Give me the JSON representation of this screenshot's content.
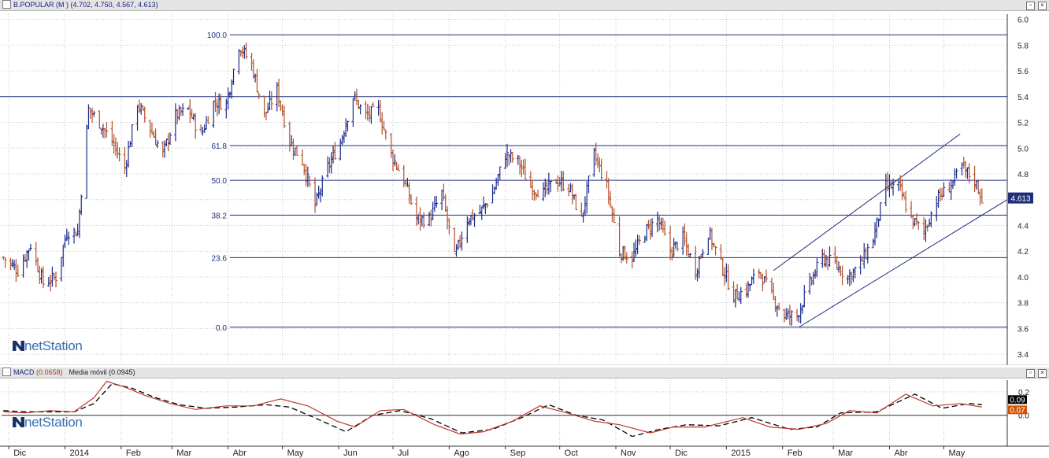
{
  "main_panel": {
    "title": "B.POPULAR (M )",
    "ohlc": "(4.702, 4.750, 4.567, 4.613)",
    "last_price_tag": "4.613",
    "logo": "netStation"
  },
  "macd_panel": {
    "macd_label": "MACD",
    "macd_value": "(0.0658)",
    "ma_label": "Media móvil",
    "ma_value": "(0.0945)",
    "tag_ma": "0.09",
    "tag_macd": "0.07",
    "logo": "netStation"
  },
  "colors": {
    "up_bar": "#1c2a8c",
    "down_bar": "#b2502a",
    "level_line": "#1f2d7a",
    "macd_line": "#c0392b",
    "signal_line": "#000000",
    "price_tag_bg": "#1f2d7a",
    "macd_tag_bg": "#d35400",
    "signal_tag_bg": "#000000"
  },
  "chart_data": [
    {
      "type": "ohlc",
      "title": "B.POPULAR (M )",
      "y_ticks": [
        "3.4",
        "3.6",
        "3.8",
        "4.0",
        "4.2",
        "4.4",
        "4.6",
        "4.8",
        "5.0",
        "5.2",
        "5.4",
        "5.6",
        "5.8",
        "6.0"
      ],
      "ylim": [
        3.34,
        6.04
      ],
      "x_ticks": [
        "Dic",
        "2014",
        "Feb",
        "Mar",
        "Abr",
        "May",
        "Jun",
        "Jul",
        "Ago",
        "Sep",
        "Oct",
        "Nov",
        "Dic",
        "2015",
        "Feb",
        "Mar",
        "Abr",
        "May"
      ],
      "grid": true,
      "fibonacci_levels": [
        {
          "label": "100.0",
          "price": 5.88
        },
        {
          "label": "61.8",
          "price": 5.02
        },
        {
          "label": "50.0",
          "price": 4.75
        },
        {
          "label": "38.2",
          "price": 4.48
        },
        {
          "label": "23.6",
          "price": 4.15
        },
        {
          "label": "0.0",
          "price": 3.61
        }
      ],
      "horizontal_line_price": 5.4,
      "channel": {
        "upper": {
          "from": [
            "2015-01-27",
            4.05
          ],
          "to": [
            "2015-05-10",
            5.11
          ]
        },
        "lower": {
          "from": [
            "2015-02-10",
            3.61
          ],
          "to": [
            "2015-06-05",
            4.6
          ]
        }
      },
      "price_path": [
        [
          "2013-11-28",
          4.15
        ],
        [
          "2013-12-06",
          4.05
        ],
        [
          "2013-12-13",
          4.25
        ],
        [
          "2013-12-20",
          3.95
        ],
        [
          "2013-12-27",
          4.0
        ],
        [
          "2014-01-02",
          4.35
        ],
        [
          "2014-01-08",
          4.35
        ],
        [
          "2014-01-14",
          5.3
        ],
        [
          "2014-01-20",
          5.2
        ],
        [
          "2014-01-27",
          5.05
        ],
        [
          "2014-02-03",
          4.85
        ],
        [
          "2014-02-10",
          5.35
        ],
        [
          "2014-02-17",
          5.15
        ],
        [
          "2014-02-24",
          4.95
        ],
        [
          "2014-03-03",
          5.25
        ],
        [
          "2014-03-10",
          5.3
        ],
        [
          "2014-03-17",
          5.1
        ],
        [
          "2014-03-24",
          5.35
        ],
        [
          "2014-03-31",
          5.35
        ],
        [
          "2014-04-07",
          5.8
        ],
        [
          "2014-04-14",
          5.65
        ],
        [
          "2014-04-21",
          5.25
        ],
        [
          "2014-04-28",
          5.45
        ],
        [
          "2014-05-05",
          5.05
        ],
        [
          "2014-05-12",
          4.9
        ],
        [
          "2014-05-19",
          4.55
        ],
        [
          "2014-05-26",
          4.85
        ],
        [
          "2014-06-02",
          5.05
        ],
        [
          "2014-06-09",
          5.4
        ],
        [
          "2014-06-16",
          5.25
        ],
        [
          "2014-06-23",
          5.3
        ],
        [
          "2014-06-30",
          4.95
        ],
        [
          "2014-07-07",
          4.75
        ],
        [
          "2014-07-14",
          4.45
        ],
        [
          "2014-07-21",
          4.45
        ],
        [
          "2014-07-28",
          4.65
        ],
        [
          "2014-08-04",
          4.15
        ],
        [
          "2014-08-11",
          4.45
        ],
        [
          "2014-08-18",
          4.5
        ],
        [
          "2014-08-25",
          4.65
        ],
        [
          "2014-09-01",
          4.95
        ],
        [
          "2014-09-08",
          4.9
        ],
        [
          "2014-09-15",
          4.7
        ],
        [
          "2014-09-22",
          4.65
        ],
        [
          "2014-09-29",
          4.75
        ],
        [
          "2014-10-06",
          4.7
        ],
        [
          "2014-10-13",
          4.45
        ],
        [
          "2014-10-20",
          4.95
        ],
        [
          "2014-10-27",
          4.7
        ],
        [
          "2014-11-03",
          4.2
        ],
        [
          "2014-11-10",
          4.15
        ],
        [
          "2014-11-17",
          4.35
        ],
        [
          "2014-11-24",
          4.45
        ],
        [
          "2014-12-01",
          4.2
        ],
        [
          "2014-12-08",
          4.3
        ],
        [
          "2014-12-15",
          4.05
        ],
        [
          "2014-12-22",
          4.35
        ],
        [
          "2014-12-29",
          4.1
        ],
        [
          "2015-01-05",
          3.85
        ],
        [
          "2015-01-12",
          3.9
        ],
        [
          "2015-01-19",
          4.05
        ],
        [
          "2015-01-26",
          3.85
        ],
        [
          "2015-02-02",
          3.7
        ],
        [
          "2015-02-09",
          3.7
        ],
        [
          "2015-02-16",
          3.95
        ],
        [
          "2015-02-23",
          4.15
        ],
        [
          "2015-03-02",
          4.1
        ],
        [
          "2015-03-09",
          4.0
        ],
        [
          "2015-03-16",
          4.1
        ],
        [
          "2015-03-23",
          4.3
        ],
        [
          "2015-03-30",
          4.7
        ],
        [
          "2015-04-06",
          4.7
        ],
        [
          "2015-04-13",
          4.45
        ],
        [
          "2015-04-20",
          4.35
        ],
        [
          "2015-04-27",
          4.6
        ],
        [
          "2015-05-04",
          4.7
        ],
        [
          "2015-05-11",
          4.85
        ],
        [
          "2015-05-18",
          4.75
        ],
        [
          "2015-05-22",
          4.613
        ]
      ]
    },
    {
      "type": "line",
      "title": "MACD (0.0658) Media móvil (0.0945)",
      "y_ticks": [
        "0.0",
        "0.2"
      ],
      "ylim": [
        -0.25,
        0.3
      ],
      "series": [
        {
          "name": "MACD",
          "values": [
            [
              "2013-11-28",
              0.03
            ],
            [
              "2013-12-10",
              0.02
            ],
            [
              "2013-12-24",
              0.04
            ],
            [
              "2014-01-06",
              0.03
            ],
            [
              "2014-01-17",
              0.15
            ],
            [
              "2014-01-24",
              0.29
            ],
            [
              "2014-02-03",
              0.24
            ],
            [
              "2014-02-14",
              0.17
            ],
            [
              "2014-02-28",
              0.1
            ],
            [
              "2014-03-14",
              0.05
            ],
            [
              "2014-03-31",
              0.08
            ],
            [
              "2014-04-15",
              0.08
            ],
            [
              "2014-04-30",
              0.14
            ],
            [
              "2014-05-15",
              0.08
            ],
            [
              "2014-05-31",
              -0.05
            ],
            [
              "2014-06-10",
              -0.1
            ],
            [
              "2014-06-24",
              0.04
            ],
            [
              "2014-07-07",
              0.05
            ],
            [
              "2014-07-24",
              -0.08
            ],
            [
              "2014-08-07",
              -0.16
            ],
            [
              "2014-08-20",
              -0.14
            ],
            [
              "2014-09-05",
              -0.05
            ],
            [
              "2014-09-20",
              0.08
            ],
            [
              "2014-10-05",
              0.02
            ],
            [
              "2014-10-20",
              -0.05
            ],
            [
              "2014-11-03",
              -0.08
            ],
            [
              "2014-11-20",
              -0.15
            ],
            [
              "2014-12-03",
              -0.1
            ],
            [
              "2014-12-20",
              -0.1
            ],
            [
              "2015-01-10",
              -0.02
            ],
            [
              "2015-01-25",
              -0.1
            ],
            [
              "2015-02-10",
              -0.12
            ],
            [
              "2015-02-25",
              -0.07
            ],
            [
              "2015-03-10",
              0.04
            ],
            [
              "2015-03-25",
              0.02
            ],
            [
              "2015-04-10",
              0.18
            ],
            [
              "2015-04-25",
              0.08
            ],
            [
              "2015-05-10",
              0.1
            ],
            [
              "2015-05-22",
              0.07
            ]
          ]
        },
        {
          "name": "Media móvil",
          "values": [
            [
              "2013-11-28",
              0.04
            ],
            [
              "2013-12-10",
              0.03
            ],
            [
              "2013-12-24",
              0.03
            ],
            [
              "2014-01-06",
              0.03
            ],
            [
              "2014-01-17",
              0.1
            ],
            [
              "2014-01-27",
              0.27
            ],
            [
              "2014-02-07",
              0.23
            ],
            [
              "2014-02-20",
              0.15
            ],
            [
              "2014-03-05",
              0.09
            ],
            [
              "2014-03-20",
              0.06
            ],
            [
              "2014-04-05",
              0.07
            ],
            [
              "2014-04-22",
              0.09
            ],
            [
              "2014-05-05",
              0.07
            ],
            [
              "2014-05-20",
              -0.03
            ],
            [
              "2014-06-05",
              -0.14
            ],
            [
              "2014-06-20",
              0.0
            ],
            [
              "2014-07-05",
              0.04
            ],
            [
              "2014-07-22",
              -0.03
            ],
            [
              "2014-08-08",
              -0.15
            ],
            [
              "2014-08-25",
              -0.12
            ],
            [
              "2014-09-10",
              -0.02
            ],
            [
              "2014-09-25",
              0.09
            ],
            [
              "2014-10-10",
              0.0
            ],
            [
              "2014-10-25",
              -0.04
            ],
            [
              "2014-11-10",
              -0.18
            ],
            [
              "2014-11-25",
              -0.12
            ],
            [
              "2014-12-10",
              -0.08
            ],
            [
              "2014-12-28",
              -0.09
            ],
            [
              "2015-01-15",
              -0.02
            ],
            [
              "2015-02-05",
              -0.12
            ],
            [
              "2015-02-20",
              -0.1
            ],
            [
              "2015-03-05",
              0.02
            ],
            [
              "2015-03-25",
              0.03
            ],
            [
              "2015-04-15",
              0.18
            ],
            [
              "2015-04-30",
              0.06
            ],
            [
              "2015-05-15",
              0.1
            ],
            [
              "2015-05-22",
              0.09
            ]
          ]
        }
      ]
    }
  ]
}
